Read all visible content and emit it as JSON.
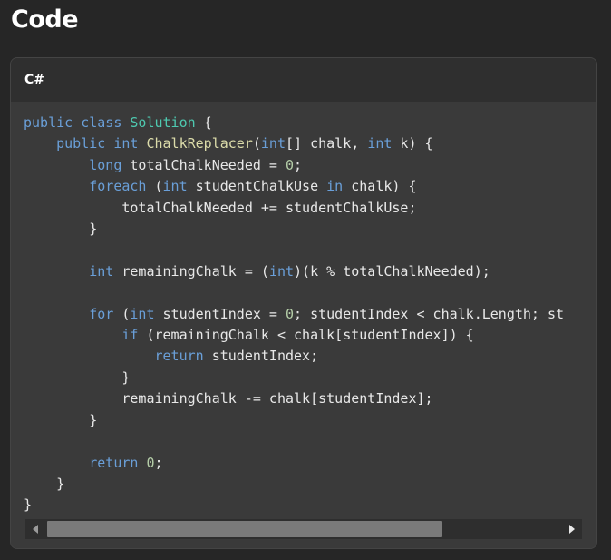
{
  "page": {
    "title": "Code"
  },
  "code_block": {
    "language": "C#",
    "lines": [
      [
        {
          "t": "public",
          "c": "kw"
        },
        {
          "t": " "
        },
        {
          "t": "class",
          "c": "kw"
        },
        {
          "t": " "
        },
        {
          "t": "Solution",
          "c": "cls"
        },
        {
          "t": " {"
        }
      ],
      [
        {
          "t": "    "
        },
        {
          "t": "public",
          "c": "kw"
        },
        {
          "t": " "
        },
        {
          "t": "int",
          "c": "kw"
        },
        {
          "t": " "
        },
        {
          "t": "ChalkReplacer",
          "c": "fn"
        },
        {
          "t": "("
        },
        {
          "t": "int",
          "c": "kw"
        },
        {
          "t": "[] chalk, "
        },
        {
          "t": "int",
          "c": "kw"
        },
        {
          "t": " k) {"
        }
      ],
      [
        {
          "t": "        "
        },
        {
          "t": "long",
          "c": "kw"
        },
        {
          "t": " totalChalkNeeded = "
        },
        {
          "t": "0",
          "c": "num"
        },
        {
          "t": ";"
        }
      ],
      [
        {
          "t": "        "
        },
        {
          "t": "foreach",
          "c": "kw"
        },
        {
          "t": " ("
        },
        {
          "t": "int",
          "c": "kw"
        },
        {
          "t": " studentChalkUse "
        },
        {
          "t": "in",
          "c": "kw"
        },
        {
          "t": " chalk) {"
        }
      ],
      [
        {
          "t": "            totalChalkNeeded += studentChalkUse;"
        }
      ],
      [
        {
          "t": "        }"
        }
      ],
      [
        {
          "t": ""
        }
      ],
      [
        {
          "t": "        "
        },
        {
          "t": "int",
          "c": "kw"
        },
        {
          "t": " remainingChalk = ("
        },
        {
          "t": "int",
          "c": "kw"
        },
        {
          "t": ")(k % totalChalkNeeded);"
        }
      ],
      [
        {
          "t": ""
        }
      ],
      [
        {
          "t": "        "
        },
        {
          "t": "for",
          "c": "kw"
        },
        {
          "t": " ("
        },
        {
          "t": "int",
          "c": "kw"
        },
        {
          "t": " studentIndex = "
        },
        {
          "t": "0",
          "c": "num"
        },
        {
          "t": "; studentIndex < chalk.Length; st"
        }
      ],
      [
        {
          "t": "            "
        },
        {
          "t": "if",
          "c": "kw"
        },
        {
          "t": " (remainingChalk < chalk[studentIndex]) {"
        }
      ],
      [
        {
          "t": "                "
        },
        {
          "t": "return",
          "c": "kw"
        },
        {
          "t": " studentIndex;"
        }
      ],
      [
        {
          "t": "            }"
        }
      ],
      [
        {
          "t": "            remainingChalk -= chalk[studentIndex];"
        }
      ],
      [
        {
          "t": "        }"
        }
      ],
      [
        {
          "t": ""
        }
      ],
      [
        {
          "t": "        "
        },
        {
          "t": "return",
          "c": "kw"
        },
        {
          "t": " "
        },
        {
          "t": "0",
          "c": "num"
        },
        {
          "t": ";"
        }
      ],
      [
        {
          "t": "    }"
        }
      ],
      [
        {
          "t": "}"
        }
      ]
    ]
  },
  "scrollbar": {
    "thumb_fraction": 0.77,
    "left_icon": "scroll-left-icon",
    "right_icon": "scroll-right-icon"
  },
  "colors": {
    "keyword": "#6a9fd8",
    "class": "#4ec9b0",
    "function": "#dcdcaa",
    "number": "#b5cea8"
  }
}
